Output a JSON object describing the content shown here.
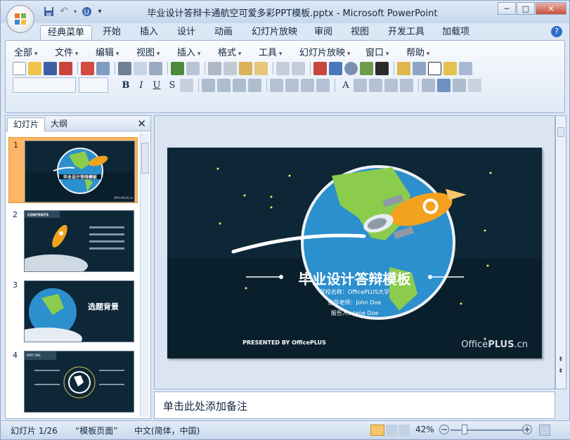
{
  "window": {
    "title": "毕业设计答辩卡通航空可爱多彩PPT模板.pptx - Microsoft PowerPoint",
    "controls": [
      "─",
      "□",
      "✕"
    ]
  },
  "ribbon_tabs": [
    "经典菜单",
    "开始",
    "插入",
    "设计",
    "动画",
    "幻灯片放映",
    "审阅",
    "视图",
    "开发工具",
    "加载项"
  ],
  "active_tab": "经典菜单",
  "classic_menu": [
    "全部",
    "文件",
    "编辑",
    "视图",
    "插入",
    "格式",
    "工具",
    "幻灯片放映",
    "窗口",
    "帮助"
  ],
  "format_buttons": [
    "B",
    "I",
    "U",
    "S",
    "A"
  ],
  "left_pane": {
    "tabs": [
      "幻灯片",
      "大纲"
    ],
    "slide_numbers": [
      "1",
      "2",
      "3",
      "4"
    ],
    "thumb2": {
      "header": "CONTENTS"
    },
    "thumb3": {
      "title": "选题背景"
    },
    "thumb4": {
      "header": "PART ONE"
    }
  },
  "slide": {
    "title": "毕业设计答辩模板",
    "lines": [
      "学校名称：OfficePLUS大学",
      "指导老师：John Doe",
      "报告人：Jane Doe"
    ],
    "presented": "PRESENTED BY OfficePLUS",
    "brand_a": "Office",
    "brand_b": "PLUS",
    "brand_c": ".cn"
  },
  "notes_placeholder": "单击此处添加备注",
  "status": {
    "slide_count": "幻灯片 1/26",
    "theme": "“模板页面”",
    "language": "中文(简体，中国)",
    "zoom": "42%"
  },
  "colors": {
    "slide_bg": "#0d2737",
    "earth_blue": "#2c8fce",
    "land_green": "#8ccc4c",
    "rocket_orange": "#f3a21e",
    "selected_thumb": "#fcb665"
  }
}
